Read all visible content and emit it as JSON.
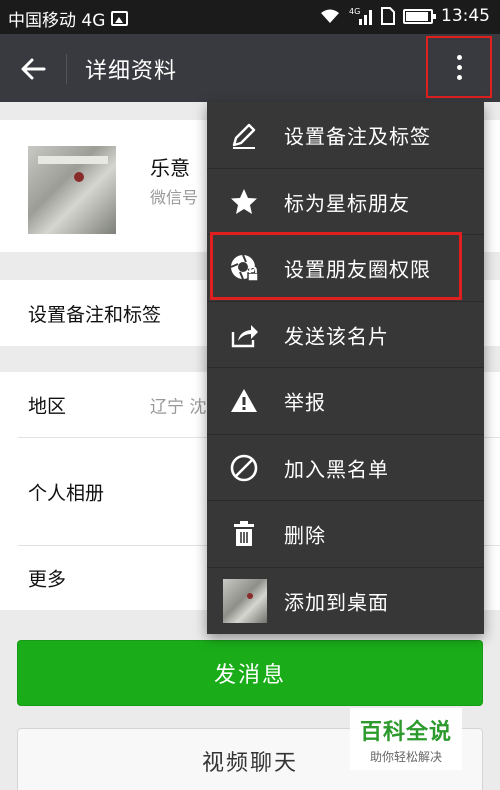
{
  "status_bar": {
    "carrier": "中国移动 4G",
    "network": "4G",
    "time": "13:45"
  },
  "header": {
    "title": "详细资料"
  },
  "profile": {
    "nickname": "乐意",
    "wechat_id_prefix": "微信号"
  },
  "remark_row": {
    "label": "设置备注和标签"
  },
  "info_rows": [
    {
      "label": "地区",
      "value": "辽宁  沈"
    },
    {
      "label": "个人相册"
    },
    {
      "label": "更多"
    }
  ],
  "buttons": {
    "send_message": "发消息",
    "video_chat": "视频聊天"
  },
  "menu": {
    "items": [
      {
        "label": "设置备注及标签",
        "icon": "pencil-icon"
      },
      {
        "label": "标为星标朋友",
        "icon": "star-icon"
      },
      {
        "label": "设置朋友圈权限",
        "icon": "moments-lock-icon"
      },
      {
        "label": "发送该名片",
        "icon": "share-icon"
      },
      {
        "label": "举报",
        "icon": "warning-icon"
      },
      {
        "label": "加入黑名单",
        "icon": "block-icon"
      },
      {
        "label": "删除",
        "icon": "trash-icon"
      },
      {
        "label": "添加到桌面",
        "icon": "avatar-thumbnail"
      }
    ]
  },
  "watermark": {
    "title": "百科全说",
    "subtitle": "助你轻松解决"
  },
  "colors": {
    "title_bar": "#393a3f",
    "menu_bg": "#373737",
    "accent_green": "#1aad19",
    "highlight_red": "#e01f1f"
  }
}
